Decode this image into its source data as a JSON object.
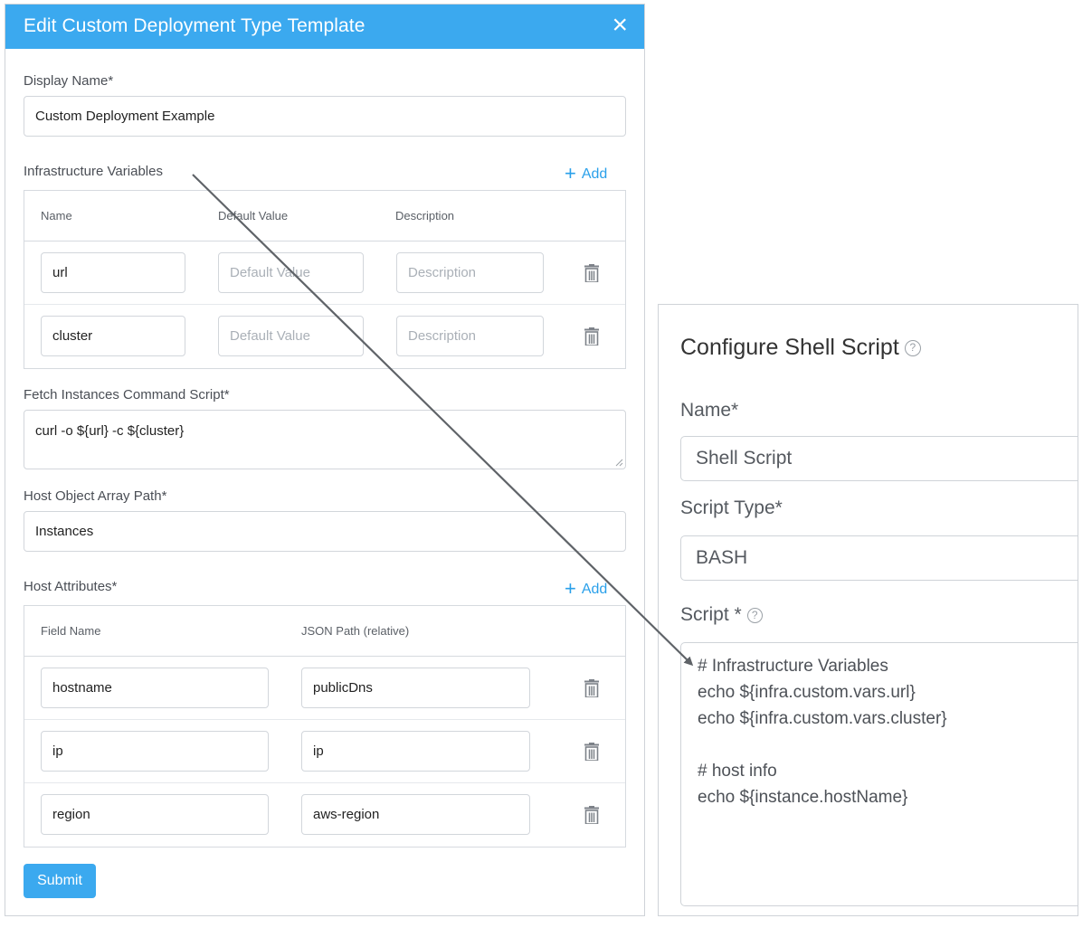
{
  "dialog": {
    "title": "Edit Custom Deployment Type Template",
    "close_icon": "close-icon",
    "display_name_label": "Display Name*",
    "display_name_value": "Custom Deployment Example",
    "infra_vars_label": "Infrastructure Variables",
    "add_label": "Add",
    "infra_columns": [
      "Name",
      "Default Value",
      "Description"
    ],
    "infra_rows": [
      {
        "name": "url",
        "default_placeholder": "Default Value",
        "description_placeholder": "Description"
      },
      {
        "name": "cluster",
        "default_placeholder": "Default Value",
        "description_placeholder": "Description"
      }
    ],
    "fetch_label": "Fetch Instances Command Script*",
    "fetch_value": "curl -o ${url} -c ${cluster}",
    "host_array_label": "Host Object Array Path*",
    "host_array_value": "Instances",
    "host_attr_label": "Host Attributes*",
    "host_columns": [
      "Field Name",
      "JSON Path (relative)"
    ],
    "host_rows": [
      {
        "field": "hostname",
        "path": "publicDns"
      },
      {
        "field": "ip",
        "path": "ip"
      },
      {
        "field": "region",
        "path": "aws-region"
      }
    ],
    "submit_label": "Submit"
  },
  "shell": {
    "title": "Configure Shell Script",
    "help_glyph": "?",
    "name_label": "Name*",
    "name_value": "Shell Script",
    "script_type_label": "Script Type*",
    "script_type_value": "BASH",
    "script_label": "Script *",
    "script_lines": [
      "# Infrastructure Variables",
      "echo ${infra.custom.vars.url}",
      "echo ${infra.custom.vars.cluster}",
      "",
      "# host info",
      "echo ${instance.hostName}"
    ]
  },
  "colors": {
    "header_blue": "#3ba9ef",
    "link_blue": "#2aa0ea",
    "arrow_gray": "#5f6368"
  }
}
